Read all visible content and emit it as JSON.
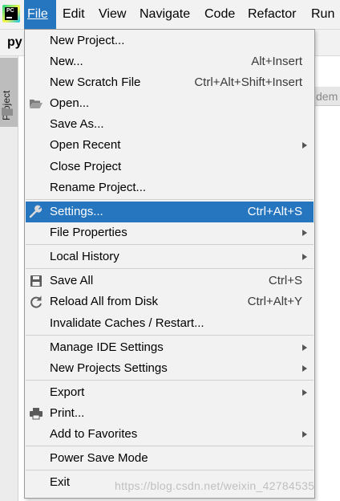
{
  "menubar": {
    "logo_text": "PC",
    "items": [
      "File",
      "Edit",
      "View",
      "Navigate",
      "Code",
      "Refactor",
      "Run"
    ],
    "active": "File"
  },
  "ide": {
    "project_name": "py",
    "tool_window_label": "Project",
    "editor_tab_partial": "dem"
  },
  "file_menu": {
    "items": [
      {
        "label": "New Project...",
        "shortcut": ""
      },
      {
        "label": "New...",
        "shortcut": "Alt+Insert"
      },
      {
        "label": "New Scratch File",
        "shortcut": "Ctrl+Alt+Shift+Insert"
      },
      {
        "label": "Open...",
        "shortcut": "",
        "icon": "folder-open-icon"
      },
      {
        "label": "Save As...",
        "shortcut": ""
      },
      {
        "label": "Open Recent",
        "shortcut": "",
        "submenu": true
      },
      {
        "label": "Close Project",
        "shortcut": ""
      },
      {
        "label": "Rename Project...",
        "shortcut": ""
      },
      {
        "label": "Settings...",
        "shortcut": "Ctrl+Alt+S",
        "icon": "wrench-icon",
        "selected": true
      },
      {
        "label": "File Properties",
        "shortcut": "",
        "submenu": true
      },
      {
        "label": "Local History",
        "shortcut": "",
        "submenu": true
      },
      {
        "label": "Save All",
        "shortcut": "Ctrl+S",
        "icon": "save-icon"
      },
      {
        "label": "Reload All from Disk",
        "shortcut": "Ctrl+Alt+Y",
        "icon": "reload-icon"
      },
      {
        "label": "Invalidate Caches / Restart...",
        "shortcut": ""
      },
      {
        "label": "Manage IDE Settings",
        "shortcut": "",
        "submenu": true
      },
      {
        "label": "New Projects Settings",
        "shortcut": "",
        "submenu": true
      },
      {
        "label": "Export",
        "shortcut": "",
        "submenu": true
      },
      {
        "label": "Print...",
        "shortcut": "",
        "icon": "printer-icon"
      },
      {
        "label": "Add to Favorites",
        "shortcut": "",
        "submenu": true
      },
      {
        "label": "Power Save Mode",
        "shortcut": ""
      },
      {
        "label": "Exit",
        "shortcut": ""
      }
    ]
  },
  "watermark": "https://blog.csdn.net/weixin_42784535",
  "colors": {
    "selection": "#2675bf",
    "menu_bg": "#f2f2f2",
    "separator": "#cfcfcf"
  }
}
